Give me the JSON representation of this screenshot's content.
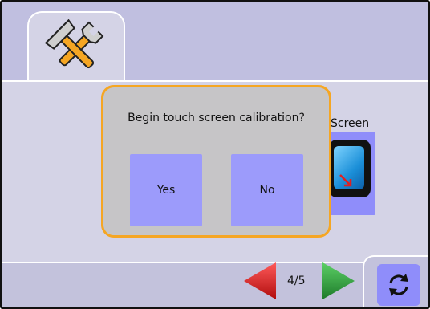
{
  "dialog": {
    "message": "Begin touch screen calibration?",
    "yes_label": "Yes",
    "no_label": "No"
  },
  "settings": {
    "screen_label": "Screen"
  },
  "pager": {
    "page_indicator": "4/5"
  },
  "icons": {
    "tools_tab": "tools-icon",
    "screen_button": "monitor-icon",
    "prev": "arrow-left-icon",
    "next": "arrow-right-icon",
    "cycle": "refresh-icon"
  },
  "colors": {
    "dialog_border": "#f5a623",
    "button_fill": "#9c9bfb",
    "prev_arrow": "#d81e1e",
    "next_arrow": "#2e9e3a"
  }
}
